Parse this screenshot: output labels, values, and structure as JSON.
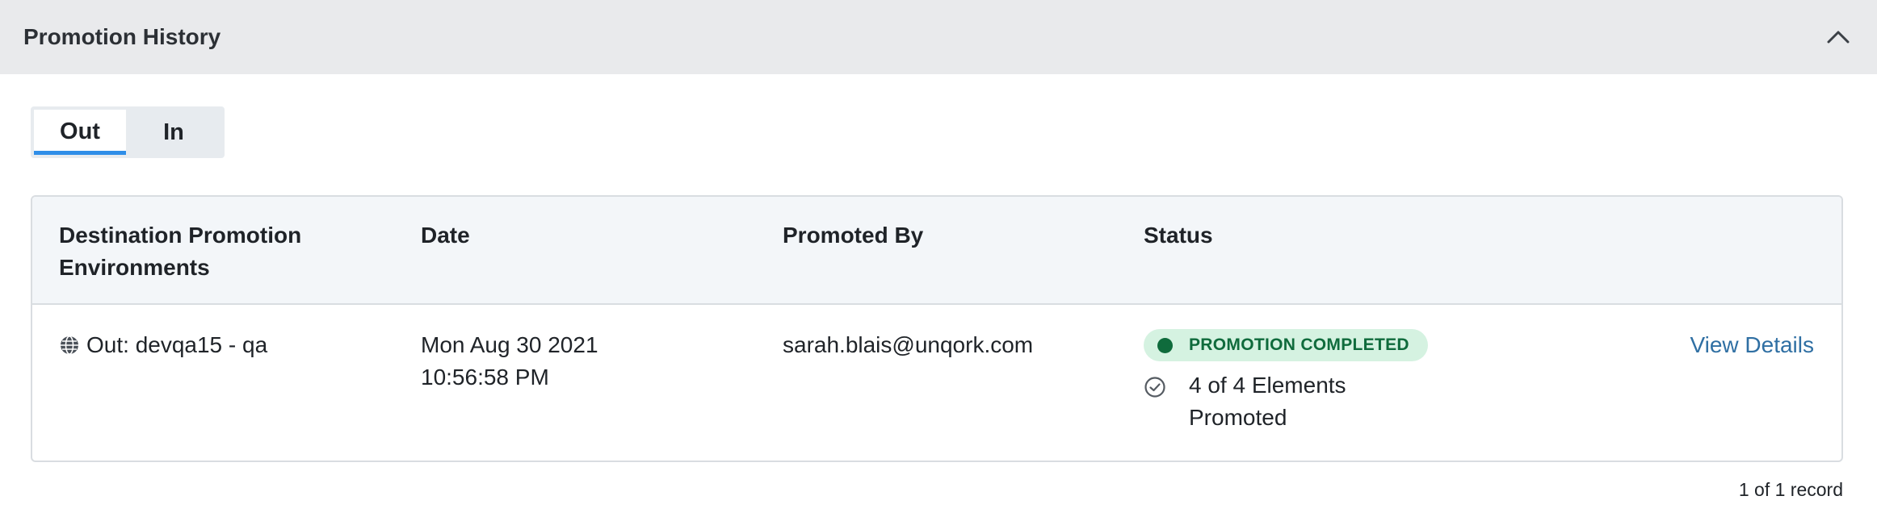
{
  "panel": {
    "title": "Promotion History"
  },
  "tabs": [
    {
      "label": "Out",
      "active": true
    },
    {
      "label": "In",
      "active": false
    }
  ],
  "table": {
    "columns": {
      "destination_line1": "Destination Promotion",
      "destination_line2": "Environments",
      "date": "Date",
      "promoted_by": "Promoted By",
      "status": "Status"
    },
    "rows": [
      {
        "environment": "Out: devqa15 - qa",
        "date_line1": "Mon Aug 30 2021",
        "date_line2": "10:56:58 PM",
        "promoted_by": "sarah.blais@unqork.com",
        "status_badge": "PROMOTION COMPLETED",
        "elements_line1": "4 of 4 Elements",
        "elements_line2": "Promoted",
        "action": "View Details"
      }
    ]
  },
  "footer": {
    "record_count": "1 of 1 record"
  },
  "colors": {
    "header_bg": "#e9eaec",
    "tab_accent": "#2f8ee8",
    "status_bg": "#d5f2e1",
    "status_fg": "#0f6b3c",
    "link": "#2f6fa3"
  },
  "icons": [
    "chevron-up-icon",
    "globe-icon",
    "check-circle-icon",
    "status-dot-icon"
  ]
}
